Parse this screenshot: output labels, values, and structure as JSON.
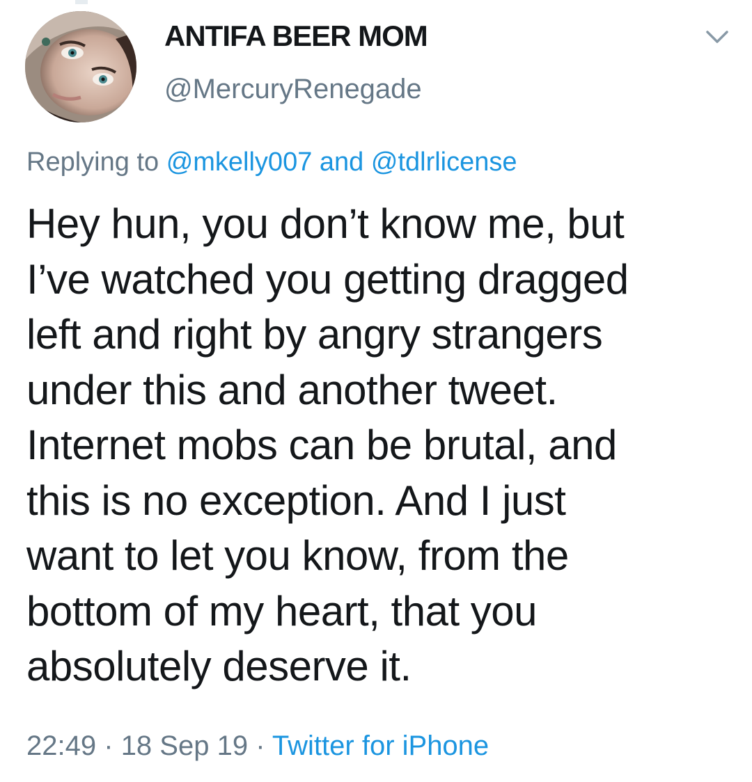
{
  "tweet": {
    "display_name": "ANTIFA BEER MOM",
    "handle": "@MercuryRenegade",
    "reply": {
      "prefix": "Replying to",
      "mention_1": "@mkelly007",
      "joiner": "and",
      "mention_2": "@tdlrlicense"
    },
    "body_lines": [
      "Hey hun, you don’t know me, but",
      "I’ve watched you getting dragged",
      "left and right by angry strangers",
      "under this and another tweet.",
      "Internet mobs can be brutal, and",
      "this is no exception. And I just",
      "want to let you know, from the",
      "bottom of my heart, that you",
      "absolutely deserve it."
    ],
    "time": "22:49",
    "separator": "·",
    "date": "18 Sep 19",
    "source": "Twitter for iPhone",
    "caret_icon": "chevron-down-icon"
  },
  "colors": {
    "link": "#1b95e0",
    "secondary_text": "#657786",
    "primary_text": "#14171a"
  }
}
